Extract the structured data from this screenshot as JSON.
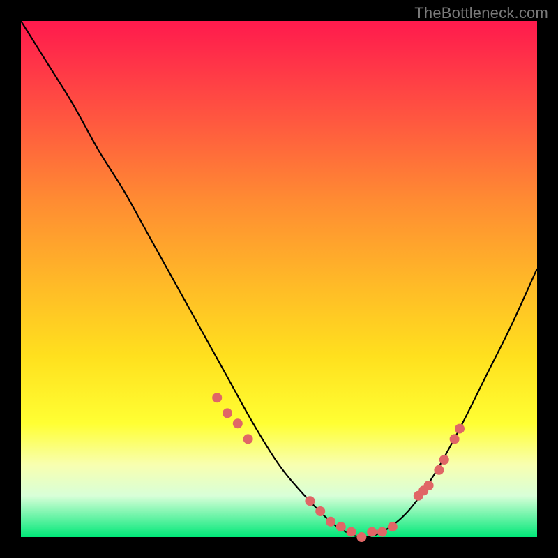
{
  "watermark": "TheBottleneck.com",
  "colors": {
    "top": "#ff1a4d",
    "mid_orange": "#ff8c32",
    "mid_yellow": "#ffff33",
    "bottom": "#00e878",
    "curve_stroke": "#000000",
    "dot_fill": "#e06666",
    "page_bg": "#000000"
  },
  "chart_data": {
    "type": "line",
    "title": "",
    "xlabel": "",
    "ylabel": "",
    "xlim": [
      0,
      100
    ],
    "ylim": [
      0,
      100
    ],
    "series": [
      {
        "name": "bottleneck-curve",
        "x": [
          0,
          5,
          10,
          15,
          20,
          25,
          30,
          35,
          40,
          45,
          50,
          55,
          60,
          63,
          66,
          70,
          75,
          80,
          85,
          90,
          95,
          100
        ],
        "values": [
          100,
          92,
          84,
          75,
          67,
          58,
          49,
          40,
          31,
          22,
          14,
          8,
          3,
          1,
          0,
          1,
          5,
          12,
          21,
          31,
          41,
          52
        ]
      }
    ],
    "highlight_points": {
      "name": "pink-dots",
      "x": [
        38,
        40,
        42,
        44,
        56,
        58,
        60,
        62,
        64,
        66,
        68,
        70,
        72,
        77,
        78,
        79,
        81,
        82,
        84,
        85
      ],
      "values": [
        27,
        24,
        22,
        19,
        7,
        5,
        3,
        2,
        1,
        0,
        1,
        1,
        2,
        8,
        9,
        10,
        13,
        15,
        19,
        21
      ]
    }
  }
}
